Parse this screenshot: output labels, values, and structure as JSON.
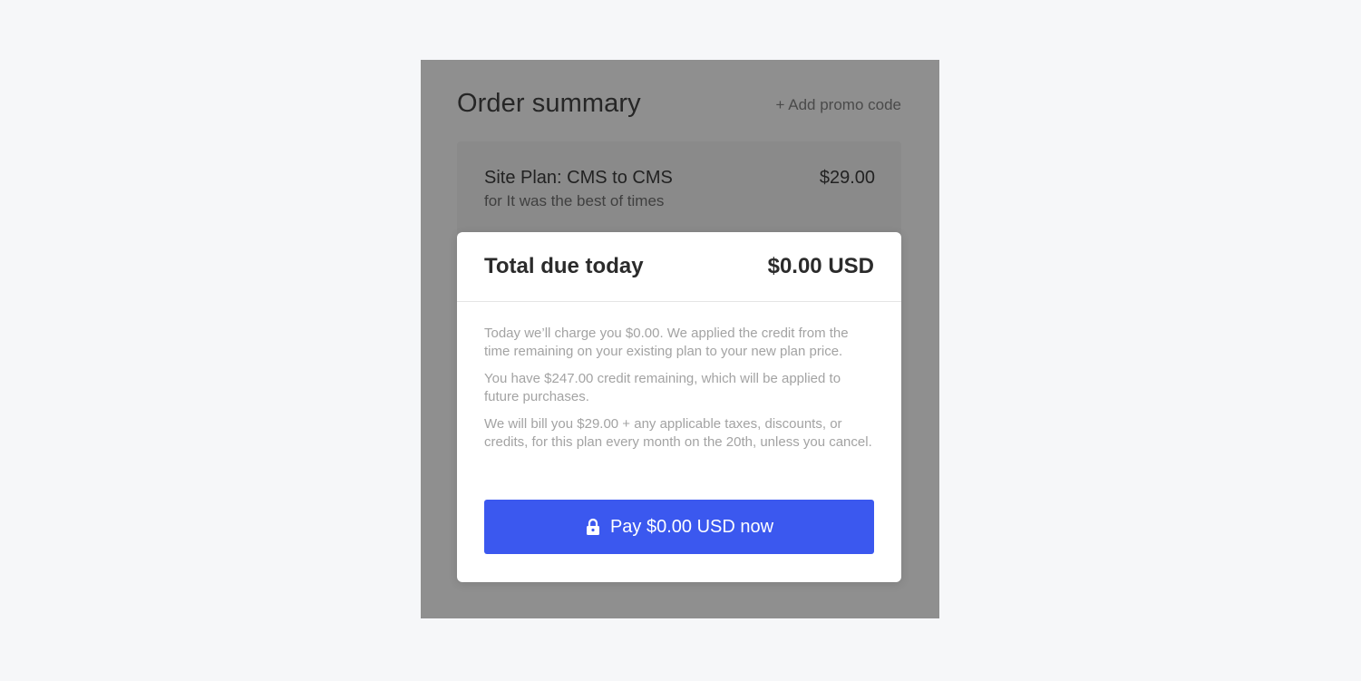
{
  "panel": {
    "title": "Order summary",
    "promo_link": "+ Add promo code"
  },
  "line_item": {
    "name": "Site Plan: CMS to CMS",
    "subtitle": "for It was the best of times",
    "price": "$29.00"
  },
  "modal": {
    "total_label": "Total due today",
    "total_value": "$0.00 USD",
    "notes": [
      "Today we’ll charge you $0.00. We applied the credit from the time remaining on your existing plan to your new plan price.",
      "You have $247.00 credit remaining, which will be applied to future purchases.",
      "We will bill you $29.00 + any applicable taxes, discounts, or credits, for this plan every month on the 20th, unless you cancel."
    ],
    "pay_button": {
      "label": "Pay $0.00 USD now",
      "icon": "lock-icon"
    }
  },
  "colors": {
    "accent": "#3b58ef",
    "page_background": "#f6f7f9",
    "overlay": "#8f8f8f"
  }
}
